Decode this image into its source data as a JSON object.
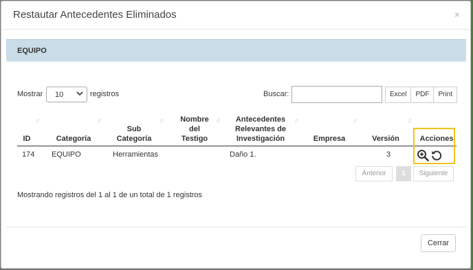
{
  "modal": {
    "title": "Restautar Antecedentes Eliminados",
    "close_glyph": "×"
  },
  "panel": {
    "title": "EQUIPO"
  },
  "table_controls": {
    "show_label": "Mostrar",
    "page_length": "10",
    "records_label": "registros",
    "search_label": "Buscar:",
    "search_value": "",
    "export_buttons": [
      "Excel",
      "PDF",
      "Print"
    ]
  },
  "table": {
    "columns": [
      [
        "ID"
      ],
      [
        "Categoría"
      ],
      [
        "Sub",
        "Categoría"
      ],
      [
        "Nombre",
        "del",
        "Testigo"
      ],
      [
        "Antecedentes",
        "Relevantes de",
        "Investigación"
      ],
      [
        "Empresa"
      ],
      [
        "Versión"
      ],
      [
        "Acciones"
      ]
    ],
    "rows": [
      {
        "id": "174",
        "categoria": "EQUIPO",
        "sub_categoria": "Herramientas",
        "nombre_testigo": "",
        "antecedentes": "Daño 1.",
        "empresa": "",
        "version": "3"
      }
    ],
    "row_actions": [
      "zoom-in-icon",
      "restore-icon"
    ]
  },
  "pagination": {
    "previous": "Anterior",
    "current": "1",
    "next": "Siguiente"
  },
  "info": "Mostrando registros del 1 al 1 de un total de 1 registros",
  "footer": {
    "close_label": "Cerrar"
  },
  "colors": {
    "panel_bg": "#c9dce8",
    "highlight": "#f0c41b",
    "icon": "#333333"
  }
}
